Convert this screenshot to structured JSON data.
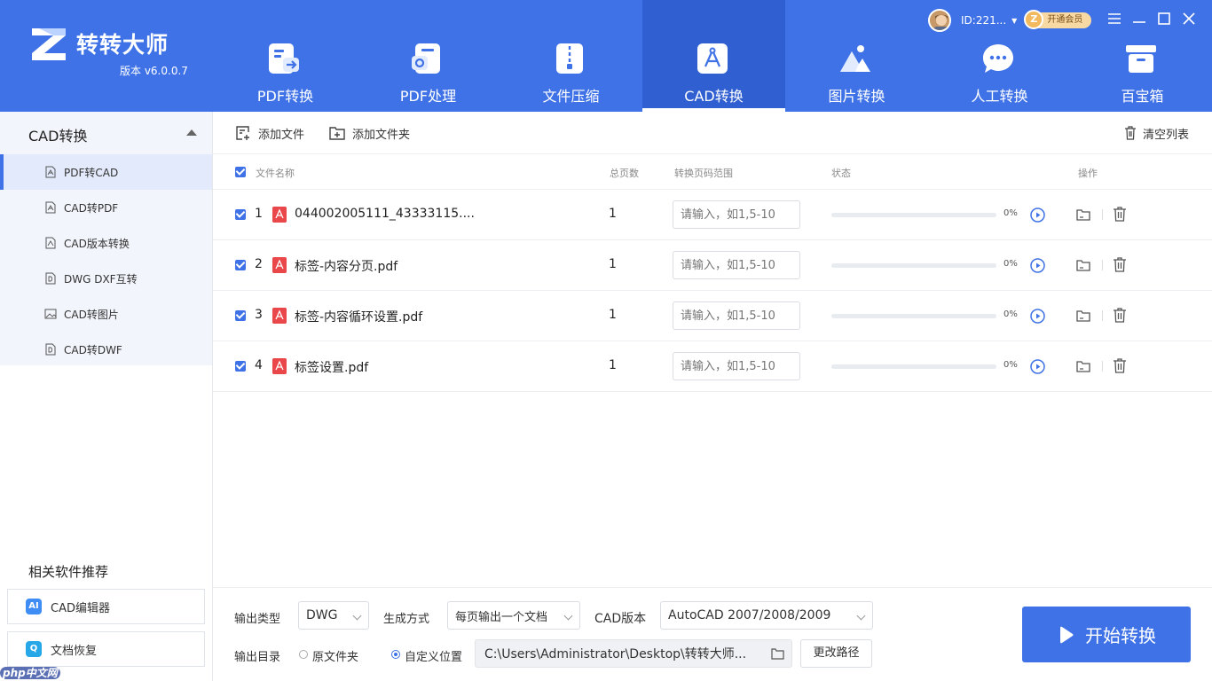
{
  "app": {
    "name": "转转大师",
    "version": "版本 v6.0.0.7"
  },
  "nav": {
    "active_index": 3,
    "items": [
      {
        "label": "PDF转换",
        "icon": "pdf-convert-icon"
      },
      {
        "label": "PDF处理",
        "icon": "pdf-process-icon"
      },
      {
        "label": "文件压缩",
        "icon": "file-compress-icon"
      },
      {
        "label": "CAD转换",
        "icon": "cad-convert-icon"
      },
      {
        "label": "图片转换",
        "icon": "image-convert-icon"
      },
      {
        "label": "人工转换",
        "icon": "manual-convert-icon"
      },
      {
        "label": "百宝箱",
        "icon": "toolbox-icon"
      }
    ]
  },
  "user": {
    "id": "ID:221...",
    "vip_label": "开通会员",
    "vip_badge": "Z"
  },
  "sidebar": {
    "group_title": "CAD转换",
    "items": [
      {
        "label": "PDF转CAD",
        "icon": "pdf-file-icon",
        "active": true
      },
      {
        "label": "CAD转PDF",
        "icon": "pdf-file-icon",
        "active": false
      },
      {
        "label": "CAD版本转换",
        "icon": "cad-file-icon",
        "active": false
      },
      {
        "label": "DWG DXF互转",
        "icon": "dwg-file-icon",
        "active": false
      },
      {
        "label": "CAD转图片",
        "icon": "image-file-icon",
        "active": false
      },
      {
        "label": "CAD转DWF",
        "icon": "dwf-file-icon",
        "active": false
      }
    ],
    "recommend_title": "相关软件推荐",
    "recommend": [
      {
        "label": "CAD编辑器",
        "badge": "AI",
        "color": "#3f8cf5"
      },
      {
        "label": "文档恢复",
        "badge": "Q",
        "color": "#26a7e8"
      }
    ],
    "watermark": "php中文网"
  },
  "toolbar": {
    "add_file": "添加文件",
    "add_folder": "添加文件夹",
    "clear_list": "清空列表"
  },
  "table": {
    "headers": {
      "name": "文件名称",
      "pages": "总页数",
      "range": "转换页码范围",
      "status": "状态",
      "actions": "操作"
    },
    "range_placeholder": "请输入，如1,5-10",
    "rows": [
      {
        "index": "1",
        "name": "044002005111_43333115....",
        "pages": "1",
        "progress": 0,
        "percent": "0%"
      },
      {
        "index": "2",
        "name": "标签-内容分页.pdf",
        "pages": "1",
        "progress": 0,
        "percent": "0%"
      },
      {
        "index": "3",
        "name": "标签-内容循环设置.pdf",
        "pages": "1",
        "progress": 0,
        "percent": "0%"
      },
      {
        "index": "4",
        "name": "标签设置.pdf",
        "pages": "1",
        "progress": 0,
        "percent": "0%"
      }
    ]
  },
  "settings": {
    "output_type_label": "输出类型",
    "output_type": "DWG",
    "mode_label": "生成方式",
    "mode": "每页输出一个文档",
    "cad_version_label": "CAD版本",
    "cad_version": "AutoCAD 2007/2008/2009",
    "output_dir_label": "输出目录",
    "radio_original": "原文件夹",
    "radio_custom": "自定义位置",
    "selected_radio": "custom",
    "path": "C:\\Users\\Administrator\\Desktop\\转转大师...",
    "change_path": "更改路径",
    "start": "开始转换"
  },
  "colors": {
    "primary": "#3f72e6",
    "header_active": "#2f5fd0",
    "pdf_red": "#e94749",
    "vip_gold": "#f8d9a3"
  }
}
